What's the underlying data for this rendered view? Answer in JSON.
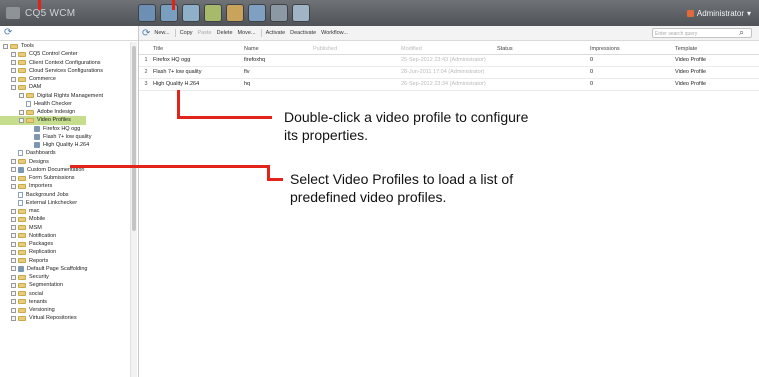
{
  "app": {
    "brand": "CQ5 WCM",
    "admin_label": "Administrator"
  },
  "toolbar": {
    "items": [
      {
        "label": "New...",
        "disabled": false
      },
      {
        "label": "Copy",
        "disabled": false
      },
      {
        "label": "Paste",
        "disabled": true
      },
      {
        "label": "Delete",
        "disabled": false
      },
      {
        "label": "Move...",
        "disabled": false
      },
      {
        "label": "Activate",
        "disabled": false
      },
      {
        "label": "Deactivate",
        "disabled": false
      },
      {
        "label": "Workflow...",
        "disabled": false
      }
    ],
    "search_placeholder": "Enter search query"
  },
  "tree": [
    {
      "label": "Tools",
      "indent": 0,
      "toggle": true,
      "icon": "folder"
    },
    {
      "label": "CQ5 Control Center",
      "indent": 1,
      "toggle": true,
      "icon": "folder"
    },
    {
      "label": "Client Context Configurations",
      "indent": 1,
      "toggle": true,
      "icon": "folder"
    },
    {
      "label": "Cloud Services Configurations",
      "indent": 1,
      "toggle": true,
      "icon": "folder"
    },
    {
      "label": "Commerce",
      "indent": 1,
      "toggle": true,
      "icon": "folder"
    },
    {
      "label": "DAM",
      "indent": 1,
      "toggle": true,
      "icon": "folder"
    },
    {
      "label": "Digital Rights Management",
      "indent": 2,
      "toggle": true,
      "icon": "folder"
    },
    {
      "label": "Health Checker",
      "indent": 2,
      "toggle": false,
      "icon": "page"
    },
    {
      "label": "Adobe Indesign",
      "indent": 2,
      "toggle": true,
      "icon": "folder"
    },
    {
      "label": "Video Profiles",
      "indent": 2,
      "toggle": true,
      "icon": "folder",
      "selected": true
    },
    {
      "label": "Firefox HQ ogg",
      "indent": 3,
      "toggle": false,
      "icon": "video"
    },
    {
      "label": "Flash 7+ low quality",
      "indent": 3,
      "toggle": false,
      "icon": "video"
    },
    {
      "label": "High Quality H.264",
      "indent": 3,
      "toggle": false,
      "icon": "video"
    },
    {
      "label": "Dashboards",
      "indent": 1,
      "toggle": false,
      "icon": "page"
    },
    {
      "label": "Designs",
      "indent": 1,
      "toggle": true,
      "icon": "folder"
    },
    {
      "label": "Custom Documentation",
      "indent": 1,
      "toggle": true,
      "icon": "video"
    },
    {
      "label": "Form Submissions",
      "indent": 1,
      "toggle": true,
      "icon": "folder"
    },
    {
      "label": "Importers",
      "indent": 1,
      "toggle": true,
      "icon": "folder"
    },
    {
      "label": "Background Jobs",
      "indent": 1,
      "toggle": false,
      "icon": "page"
    },
    {
      "label": "External Linkchecker",
      "indent": 1,
      "toggle": false,
      "icon": "page"
    },
    {
      "label": "mac",
      "indent": 1,
      "toggle": true,
      "icon": "folder"
    },
    {
      "label": "Mobile",
      "indent": 1,
      "toggle": true,
      "icon": "folder"
    },
    {
      "label": "MSM",
      "indent": 1,
      "toggle": true,
      "icon": "folder"
    },
    {
      "label": "Notification",
      "indent": 1,
      "toggle": true,
      "icon": "folder"
    },
    {
      "label": "Packages",
      "indent": 1,
      "toggle": true,
      "icon": "folder"
    },
    {
      "label": "Replication",
      "indent": 1,
      "toggle": true,
      "icon": "folder"
    },
    {
      "label": "Reports",
      "indent": 1,
      "toggle": true,
      "icon": "folder"
    },
    {
      "label": "Default Page Scaffolding",
      "indent": 1,
      "toggle": true,
      "icon": "video"
    },
    {
      "label": "Security",
      "indent": 1,
      "toggle": true,
      "icon": "folder"
    },
    {
      "label": "Segmentation",
      "indent": 1,
      "toggle": true,
      "icon": "folder"
    },
    {
      "label": "social",
      "indent": 1,
      "toggle": true,
      "icon": "folder"
    },
    {
      "label": "tenants",
      "indent": 1,
      "toggle": true,
      "icon": "folder"
    },
    {
      "label": "Versioning",
      "indent": 1,
      "toggle": true,
      "icon": "folder"
    },
    {
      "label": "Virtual Repositories",
      "indent": 1,
      "toggle": true,
      "icon": "folder"
    }
  ],
  "grid": {
    "columns": [
      "Title",
      "Name",
      "Published",
      "Modified",
      "Status",
      "Impressions",
      "Template"
    ],
    "rows": [
      {
        "num": "1",
        "title": "Firefox HQ ogg",
        "name": "firefoxhq",
        "published": "",
        "modified": "25-Sep-2012 23:43 (Administrator)",
        "status": "",
        "impressions": "0",
        "template": "Video Profile"
      },
      {
        "num": "2",
        "title": "Flash 7+ low quality",
        "name": "flv",
        "published": "",
        "modified": "28-Jun-2011 17:04 (Administrator)",
        "status": "",
        "impressions": "0",
        "template": "Video Profile"
      },
      {
        "num": "3",
        "title": "High Quality H.264",
        "name": "hq",
        "published": "",
        "modified": "26-Sep-2012 23:34 (Administrator)",
        "status": "",
        "impressions": "0",
        "template": "Video Profile"
      }
    ]
  },
  "callouts": {
    "double_click": "Double-click a video profile to configure its properties.",
    "select_profiles": "Select Video Profiles to load a list of predefined video profiles."
  },
  "colors": {
    "accent": "#e2231a",
    "selection": "#c6dd8e",
    "topbar": "#5b5f63"
  }
}
